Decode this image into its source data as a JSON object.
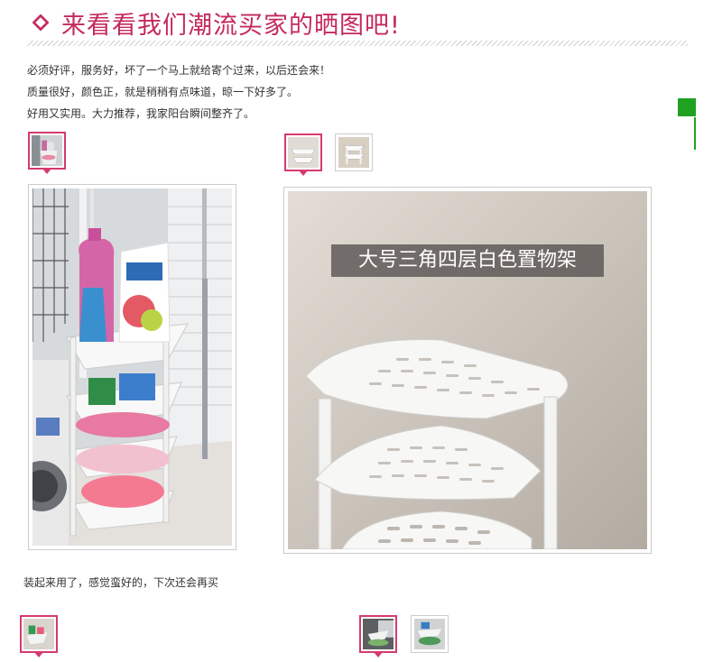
{
  "header": {
    "title": "来看看我们潮流买家的晒图吧!"
  },
  "review1": {
    "lines": [
      "必须好评，服务好，坏了一个马上就给寄个过来，以后还会来！",
      "质量很好，颜色正，就是稍稍有点味道，晾一下好多了。",
      "好用又实用。大力推荐，我家阳台瞬间整齐了。"
    ]
  },
  "product_caption": "大号三角四层白色置物架",
  "review2": {
    "text": "装起来用了，感觉蛮好的，下次还会再买"
  },
  "colors": {
    "accent": "#c42a5b",
    "thumb_border": "#d63a6e",
    "side_marker": "#21a121"
  }
}
